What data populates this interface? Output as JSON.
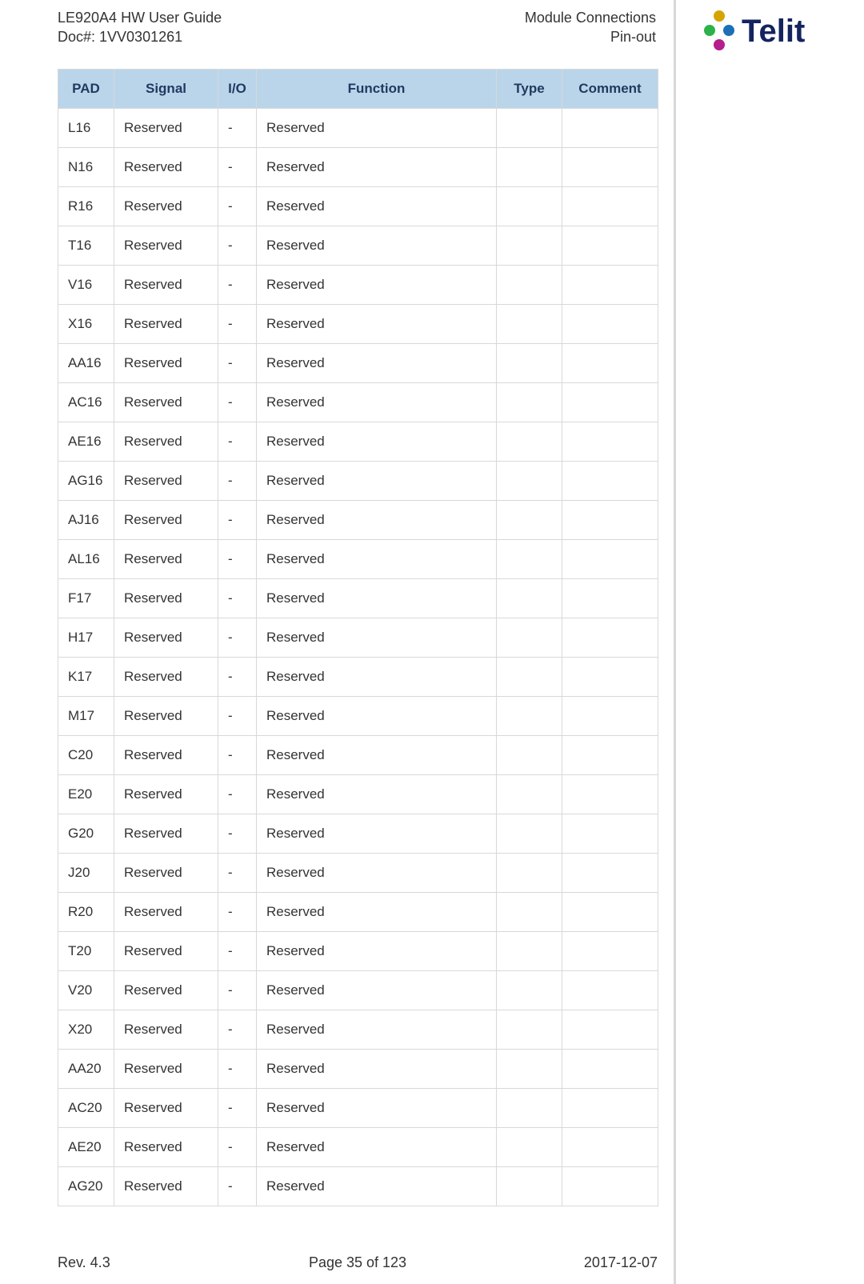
{
  "header": {
    "title_line1": "LE920A4 HW User Guide",
    "title_line2": "Doc#: 1VV0301261",
    "section_line1": "Module Connections",
    "section_line2": "Pin-out"
  },
  "logo": {
    "brand": "Telit"
  },
  "table": {
    "headers": {
      "pad": "PAD",
      "signal": "Signal",
      "io": "I/O",
      "function": "Function",
      "type": "Type",
      "comment": "Comment"
    },
    "rows": [
      {
        "pad": "L16",
        "signal": "Reserved",
        "io": "-",
        "function": "Reserved",
        "type": "",
        "comment": ""
      },
      {
        "pad": "N16",
        "signal": "Reserved",
        "io": "-",
        "function": "Reserved",
        "type": "",
        "comment": ""
      },
      {
        "pad": "R16",
        "signal": "Reserved",
        "io": "-",
        "function": "Reserved",
        "type": "",
        "comment": ""
      },
      {
        "pad": "T16",
        "signal": "Reserved",
        "io": "-",
        "function": "Reserved",
        "type": "",
        "comment": ""
      },
      {
        "pad": "V16",
        "signal": "Reserved",
        "io": "-",
        "function": "Reserved",
        "type": "",
        "comment": ""
      },
      {
        "pad": "X16",
        "signal": "Reserved",
        "io": "-",
        "function": "Reserved",
        "type": "",
        "comment": ""
      },
      {
        "pad": "AA16",
        "signal": "Reserved",
        "io": "-",
        "function": "Reserved",
        "type": "",
        "comment": ""
      },
      {
        "pad": "AC16",
        "signal": "Reserved",
        "io": "-",
        "function": "Reserved",
        "type": "",
        "comment": ""
      },
      {
        "pad": "AE16",
        "signal": "Reserved",
        "io": "-",
        "function": "Reserved",
        "type": "",
        "comment": ""
      },
      {
        "pad": "AG16",
        "signal": "Reserved",
        "io": "-",
        "function": "Reserved",
        "type": "",
        "comment": ""
      },
      {
        "pad": "AJ16",
        "signal": "Reserved",
        "io": "-",
        "function": "Reserved",
        "type": "",
        "comment": ""
      },
      {
        "pad": "AL16",
        "signal": "Reserved",
        "io": "-",
        "function": "Reserved",
        "type": "",
        "comment": ""
      },
      {
        "pad": "F17",
        "signal": "Reserved",
        "io": "-",
        "function": "Reserved",
        "type": "",
        "comment": ""
      },
      {
        "pad": "H17",
        "signal": "Reserved",
        "io": "-",
        "function": "Reserved",
        "type": "",
        "comment": ""
      },
      {
        "pad": "K17",
        "signal": "Reserved",
        "io": "-",
        "function": "Reserved",
        "type": "",
        "comment": ""
      },
      {
        "pad": "M17",
        "signal": "Reserved",
        "io": "-",
        "function": "Reserved",
        "type": "",
        "comment": ""
      },
      {
        "pad": "C20",
        "signal": "Reserved",
        "io": "-",
        "function": "Reserved",
        "type": "",
        "comment": ""
      },
      {
        "pad": "E20",
        "signal": "Reserved",
        "io": "-",
        "function": "Reserved",
        "type": "",
        "comment": ""
      },
      {
        "pad": "G20",
        "signal": "Reserved",
        "io": "-",
        "function": "Reserved",
        "type": "",
        "comment": ""
      },
      {
        "pad": "J20",
        "signal": "Reserved",
        "io": "-",
        "function": "Reserved",
        "type": "",
        "comment": ""
      },
      {
        "pad": "R20",
        "signal": "Reserved",
        "io": "-",
        "function": "Reserved",
        "type": "",
        "comment": ""
      },
      {
        "pad": "T20",
        "signal": "Reserved",
        "io": "-",
        "function": "Reserved",
        "type": "",
        "comment": ""
      },
      {
        "pad": "V20",
        "signal": "Reserved",
        "io": "-",
        "function": "Reserved",
        "type": "",
        "comment": ""
      },
      {
        "pad": "X20",
        "signal": "Reserved",
        "io": "-",
        "function": "Reserved",
        "type": "",
        "comment": ""
      },
      {
        "pad": "AA20",
        "signal": "Reserved",
        "io": "-",
        "function": "Reserved",
        "type": "",
        "comment": ""
      },
      {
        "pad": "AC20",
        "signal": "Reserved",
        "io": "-",
        "function": "Reserved",
        "type": "",
        "comment": ""
      },
      {
        "pad": "AE20",
        "signal": "Reserved",
        "io": "-",
        "function": "Reserved",
        "type": "",
        "comment": ""
      },
      {
        "pad": "AG20",
        "signal": "Reserved",
        "io": "-",
        "function": "Reserved",
        "type": "",
        "comment": ""
      }
    ]
  },
  "footer": {
    "rev": "Rev. 4.3",
    "page": "Page 35 of 123",
    "date": "2017-12-07"
  }
}
